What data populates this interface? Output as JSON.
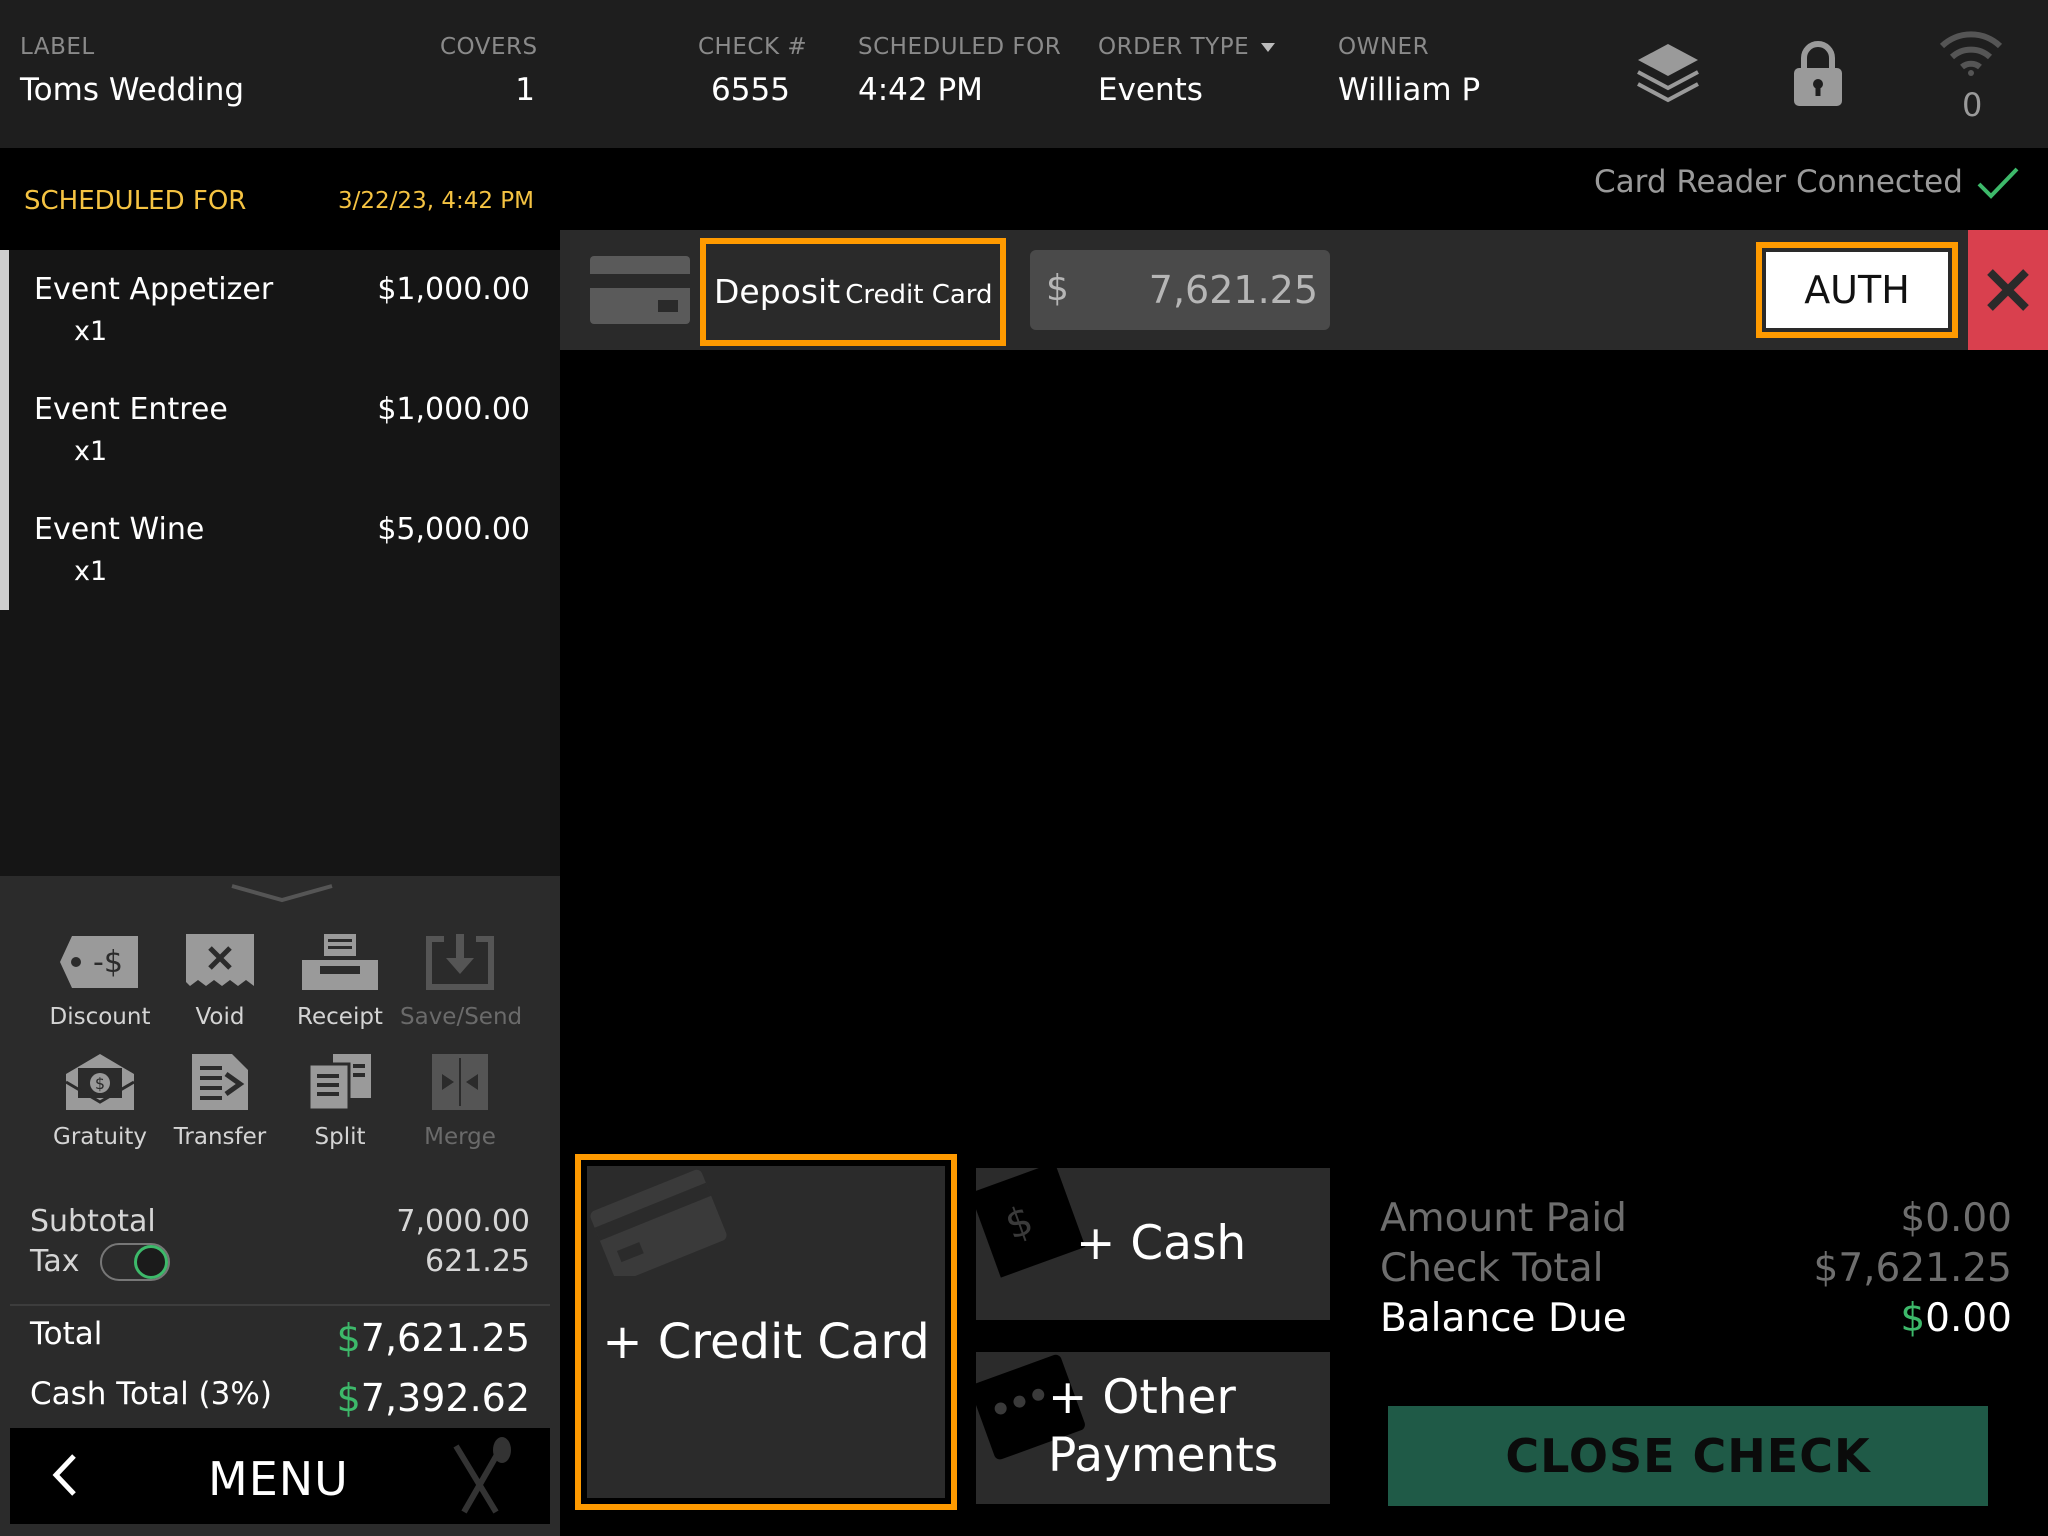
{
  "header": {
    "label_caption": "LABEL",
    "label_value": "Toms Wedding",
    "covers_caption": "COVERS",
    "covers_value": "1",
    "check_caption": "CHECK #",
    "check_value": "6555",
    "scheduled_caption": "SCHEDULED FOR",
    "scheduled_value": "4:42 PM",
    "order_type_caption": "ORDER TYPE",
    "order_type_value": "Events",
    "owner_caption": "OWNER",
    "owner_value": "William P",
    "wifi_count": "0"
  },
  "left": {
    "scheduled_label": "SCHEDULED FOR",
    "scheduled_date": "3/22/23, 4:42 PM",
    "items": [
      {
        "name": "Event Appetizer",
        "qty": "x1",
        "price": "$1,000.00"
      },
      {
        "name": "Event Entree",
        "qty": "x1",
        "price": "$1,000.00"
      },
      {
        "name": "Event Wine",
        "qty": "x1",
        "price": "$5,000.00"
      }
    ],
    "actions": {
      "discount": "Discount",
      "void": "Void",
      "receipt": "Receipt",
      "save_send": "Save/Send",
      "gratuity": "Gratuity",
      "transfer": "Transfer",
      "split": "Split",
      "merge": "Merge"
    },
    "totals": {
      "subtotal_label": "Subtotal",
      "subtotal_value": "7,000.00",
      "tax_label": "Tax",
      "tax_value": "621.25",
      "tax_enabled": true,
      "total_label": "Total",
      "total_currency": "$",
      "total_value": "7,621.25",
      "cash_total_label": "Cash Total (3%)",
      "cash_total_currency": "$",
      "cash_total_value": "7,392.62"
    },
    "menu_label": "MENU"
  },
  "status": {
    "text": "Card Reader Connected"
  },
  "payment": {
    "method_main": "Deposit",
    "method_sub": "Credit Card",
    "currency": "$",
    "amount": "7,621.25",
    "auth_label": "AUTH"
  },
  "buttons": {
    "credit_card": "+ Credit Card",
    "cash": "+ Cash",
    "other_line1": "+ Other",
    "other_line2": "Payments",
    "close_check": "CLOSE CHECK"
  },
  "summary": {
    "amount_paid_label": "Amount Paid",
    "amount_paid_value": "$0.00",
    "check_total_label": "Check Total",
    "check_total_value": "$7,621.25",
    "balance_due_label": "Balance Due",
    "balance_due_currency": "$",
    "balance_due_value": "0.00"
  },
  "colors": {
    "accent_highlight": "#ff9a00",
    "scheduled_text": "#f5c342",
    "money_green": "#3db96a",
    "close_check_bg": "#1f5a47",
    "remove_red": "#d9404e"
  }
}
